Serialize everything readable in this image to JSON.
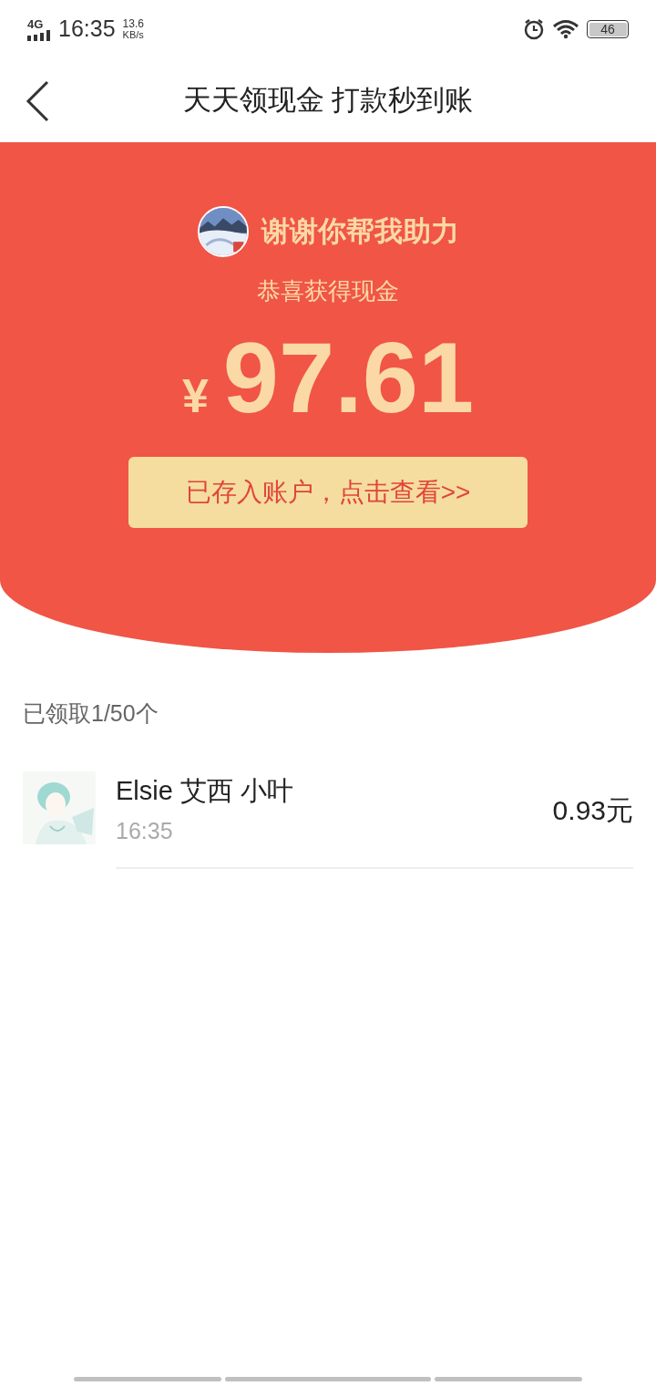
{
  "status_bar": {
    "network": "4G",
    "time": "16:35",
    "speed": "13.6",
    "speed_unit": "KB/s",
    "battery": "46"
  },
  "header": {
    "title": "天天领现金 打款秒到账"
  },
  "banner": {
    "greeting": "谢谢你帮我助力",
    "subtitle": "恭喜获得现金",
    "currency": "¥",
    "amount": "97.61",
    "button": "已存入账户，点击查看>>"
  },
  "claims": {
    "summary": "已领取1/50个",
    "rows": [
      {
        "name": "Elsie 艾西 小叶",
        "time": "16:35",
        "amount": "0.93元"
      }
    ]
  }
}
